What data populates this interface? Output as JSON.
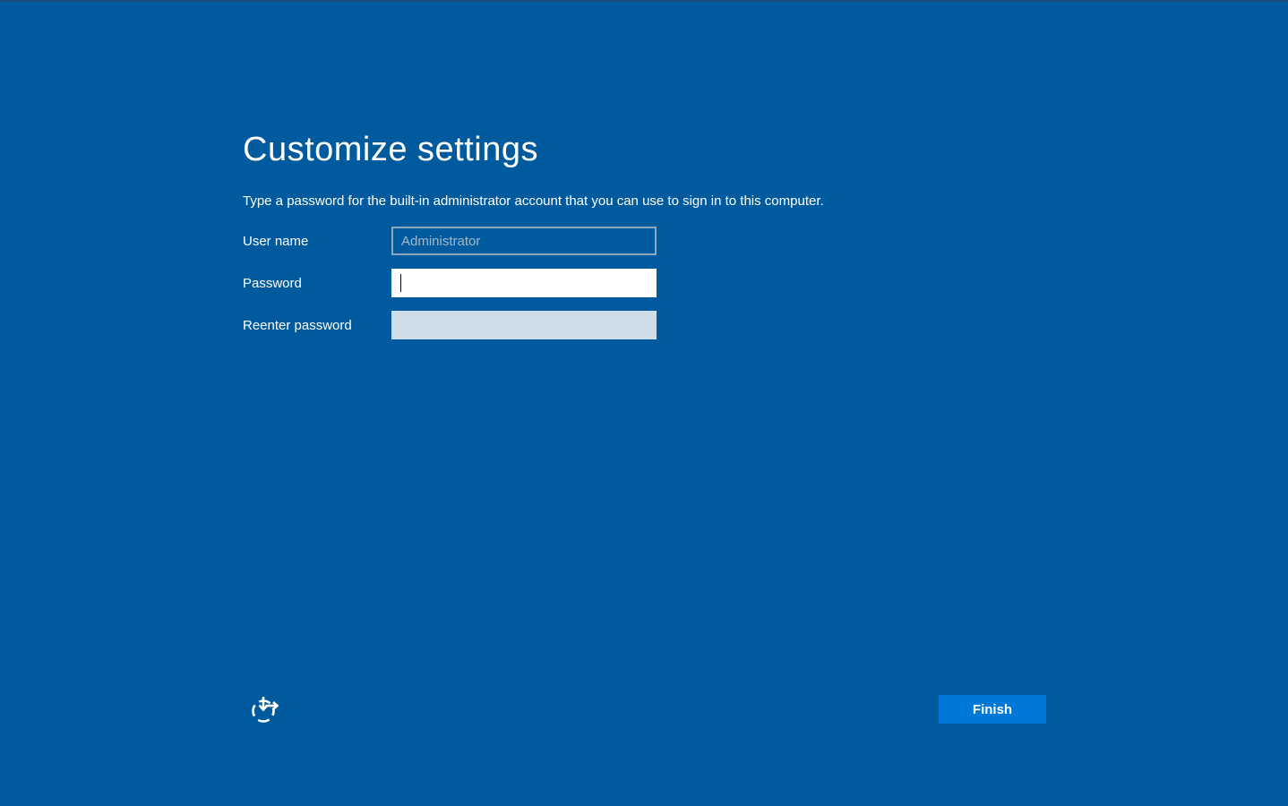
{
  "page": {
    "title": "Customize settings",
    "subtitle": "Type a password for the built-in administrator account that you can use to sign in to this computer."
  },
  "form": {
    "fields": [
      {
        "label": "User name",
        "placeholder": "Administrator",
        "value": "",
        "state": "readonly"
      },
      {
        "label": "Password",
        "placeholder": "",
        "value": "",
        "state": "focused"
      },
      {
        "label": "Reenter password",
        "placeholder": "",
        "value": "",
        "state": "inactive"
      }
    ]
  },
  "footer": {
    "finish_label": "Finish",
    "icons": [
      "ease-of-access-icon"
    ]
  },
  "colors": {
    "background": "#005a9e",
    "accent_button": "#0078d7",
    "inactive_field_fill": "#cfdde8",
    "username_border": "#8fa8bf",
    "placeholder_text": "#a3b9c9",
    "text": "#ffffff"
  }
}
